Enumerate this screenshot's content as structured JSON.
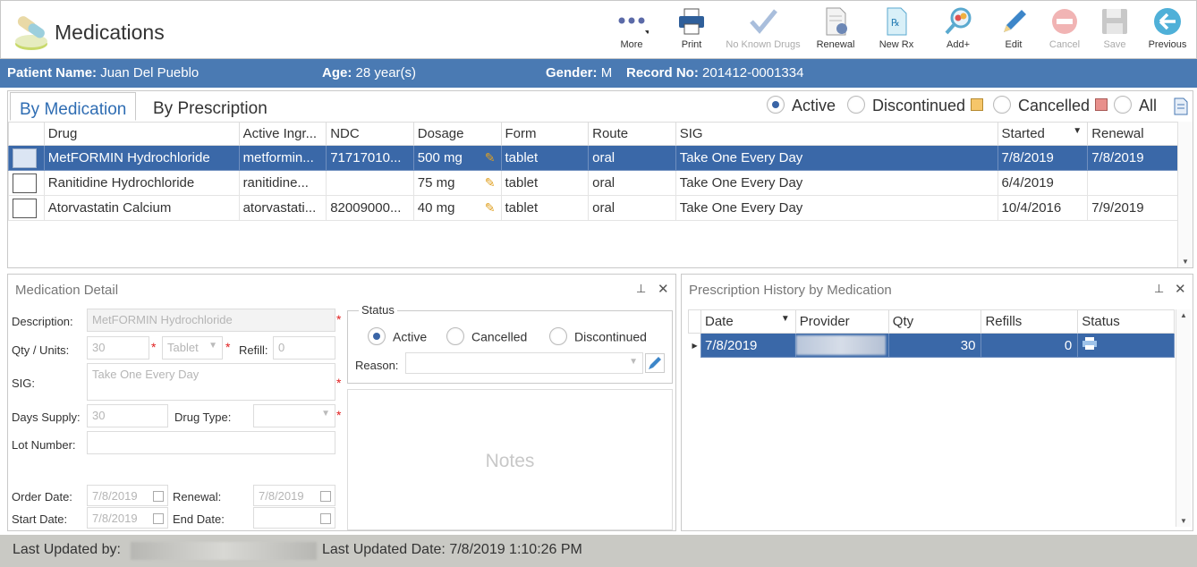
{
  "app": {
    "title": "Medications"
  },
  "toolbar": [
    {
      "id": "more",
      "label": "More",
      "icon": "more-dots-icon",
      "disabled": false
    },
    {
      "id": "print",
      "label": "Print",
      "icon": "printer-icon",
      "disabled": false
    },
    {
      "id": "no-known-drugs",
      "label": "No Known Drugs",
      "icon": "checkmark-icon",
      "disabled": true
    },
    {
      "id": "renewal",
      "label": "Renewal",
      "icon": "renewal-document-icon",
      "disabled": false
    },
    {
      "id": "new-rx",
      "label": "New Rx",
      "icon": "rx-document-icon",
      "disabled": false
    },
    {
      "id": "add-plus",
      "label": "Add+",
      "icon": "magnifier-pill-icon",
      "disabled": false
    },
    {
      "id": "edit",
      "label": "Edit",
      "icon": "pencil-icon",
      "disabled": false
    },
    {
      "id": "cancel",
      "label": "Cancel",
      "icon": "no-entry-icon",
      "disabled": true
    },
    {
      "id": "save",
      "label": "Save",
      "icon": "floppy-disk-icon",
      "disabled": true
    },
    {
      "id": "previous",
      "label": "Previous",
      "icon": "arrow-left-circle-icon",
      "disabled": false
    }
  ],
  "patient": {
    "name_label": "Patient Name:",
    "name": "Juan Del Pueblo",
    "age_label": "Age:",
    "age": "28 year(s)",
    "gender_label": "Gender:",
    "gender": "M",
    "record_label": "Record No:",
    "record": "201412-0001334"
  },
  "tabs": {
    "by_medication": "By Medication",
    "by_prescription": "By Prescription"
  },
  "filters": {
    "active": "Active",
    "discontinued": "Discontinued",
    "cancelled": "Cancelled",
    "all": "All",
    "selected": "Active",
    "discontinued_color": "#f6c66a",
    "cancelled_color": "#e8908c"
  },
  "med_grid": {
    "columns": [
      "Drug",
      "Active Ingr...",
      "NDC",
      "Dosage",
      "Form",
      "Route",
      "SIG",
      "Started",
      "Renewal"
    ],
    "rows": [
      {
        "drug": "MetFORMIN Hydrochloride",
        "ingredient": "metformin...",
        "ndc": "71717010...",
        "dosage": "500 mg",
        "form": "tablet",
        "route": "oral",
        "sig": "Take One Every Day",
        "started": "7/8/2019",
        "renewal": "7/8/2019",
        "selected": true
      },
      {
        "drug": "Ranitidine Hydrochloride",
        "ingredient": "ranitidine...",
        "ndc": "",
        "dosage": "75 mg",
        "form": "tablet",
        "route": "oral",
        "sig": "Take One Every Day",
        "started": "6/4/2019",
        "renewal": "",
        "selected": false
      },
      {
        "drug": "Atorvastatin Calcium",
        "ingredient": "atorvastati...",
        "ndc": "82009000...",
        "dosage": "40 mg",
        "form": "tablet",
        "route": "oral",
        "sig": "Take One Every Day",
        "started": "10/4/2016",
        "renewal": "7/9/2019",
        "selected": false
      }
    ]
  },
  "detail": {
    "title": "Medication Detail",
    "description_label": "Description:",
    "description": "MetFORMIN Hydrochloride",
    "qty_label": "Qty / Units:",
    "qty": "30",
    "units": "Tablet",
    "refill_label": "Refill:",
    "refill": "0",
    "sig_label": "SIG:",
    "sig": "Take One Every Day",
    "days_label": "Days Supply:",
    "days": "30",
    "drugtype_label": "Drug Type:",
    "drugtype": "",
    "lot_label": "Lot Number:",
    "lot": "",
    "order_label": "Order Date:",
    "order": "7/8/2019",
    "renewal_label": "Renewal:",
    "renewal": "7/8/2019",
    "start_label": "Start Date:",
    "start": "7/8/2019",
    "end_label": "End Date:",
    "end": "",
    "status_title": "Status",
    "status_active": "Active",
    "status_cancelled": "Cancelled",
    "status_discontinued": "Discontinued",
    "reason_label": "Reason:",
    "notes_placeholder": "Notes"
  },
  "history": {
    "title": "Prescription History by Medication",
    "columns": [
      "Date",
      "Provider",
      "Qty",
      "Refills",
      "Status"
    ],
    "rows": [
      {
        "date": "7/8/2019",
        "provider": "",
        "qty": "30",
        "refills": "0",
        "status_icon": "printer-icon"
      }
    ]
  },
  "footer": {
    "updated_by_label": "Last Updated by:",
    "updated_by": "",
    "updated_date_label": "Last Updated Date:",
    "updated_date": "7/8/2019 1:10:26 PM"
  }
}
